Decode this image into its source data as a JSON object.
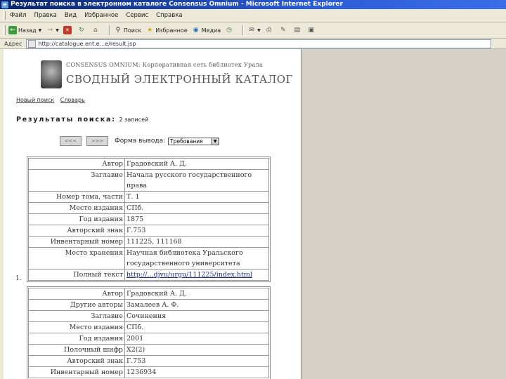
{
  "window": {
    "title": "Результат поиска в электронном каталоге Consensus Omnium - Microsoft Internet Explorer"
  },
  "menu": [
    "Файл",
    "Правка",
    "Вид",
    "Избранное",
    "Сервис",
    "Справка"
  ],
  "toolbar": {
    "back": "Назад",
    "search": "Поиск",
    "favorites": "Избранное",
    "media": "Медиа"
  },
  "address": {
    "label": "Адрес",
    "url": "http://catalogue.ent.e...e/result.jsp"
  },
  "logo": {
    "line1": "CONSENSUS OMNIUM: Корпоративная сеть библиотек Урала",
    "line2": "СВОДНЫЙ ЭЛЕКТРОННЫЙ КАТАЛОГ"
  },
  "links": {
    "new_search": "Новый поиск",
    "dictionary": "Словарь"
  },
  "results": {
    "heading": "Результаты поиска:",
    "count": "2 записей"
  },
  "nav": {
    "prev": "<<<",
    "next": ">>>",
    "format_label": "Форма вывода:",
    "format_value": "Требования"
  },
  "records": [
    {
      "number": "1.",
      "rows": [
        {
          "k": "Автор",
          "v": "Градовский А. Д."
        },
        {
          "k": "Заглавие",
          "v": "Начала русского государственного права"
        },
        {
          "k": "Номер тома, части",
          "v": "Т. 1"
        },
        {
          "k": "Место издания",
          "v": "СПб."
        },
        {
          "k": "Год издания",
          "v": "1875"
        },
        {
          "k": "Авторский знак",
          "v": "Г.753"
        },
        {
          "k": "Инвентарный номер",
          "v": "111225, 111168"
        },
        {
          "k": "Место хранения",
          "v": "Научная библиотека Уральского государственного университета"
        },
        {
          "k": "Полный текст",
          "v": "http://...djvu/urgu/111225/index.html"
        }
      ]
    },
    {
      "rows": [
        {
          "k": "Автор",
          "v": "Градовский А. Д."
        },
        {
          "k": "Другие авторы",
          "v": "Замалеев А. Ф."
        },
        {
          "k": "Заглавие",
          "v": "Сочинения"
        },
        {
          "k": "Место издания",
          "v": "СПб."
        },
        {
          "k": "Год издания",
          "v": "2001"
        },
        {
          "k": "Полочный шифр",
          "v": "Х2(2)"
        },
        {
          "k": "Авторский знак",
          "v": "Г.753"
        },
        {
          "k": "Инвентарный номер",
          "v": "1236934"
        }
      ]
    }
  ]
}
